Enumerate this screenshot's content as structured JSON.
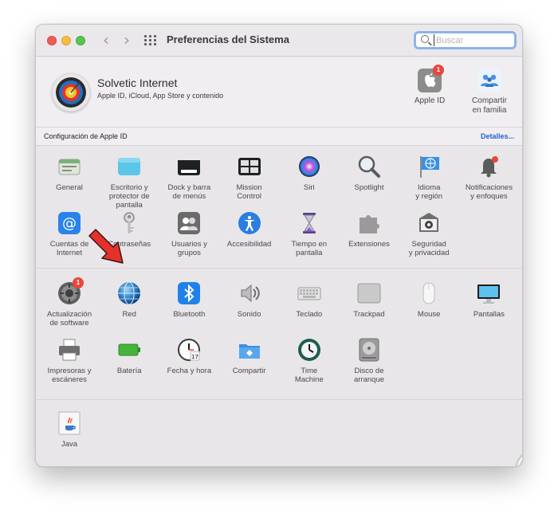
{
  "window": {
    "title": "Preferencias del Sistema"
  },
  "toolbar": {
    "back_icon": "chevron-left-icon",
    "forward_icon": "chevron-right-icon",
    "grid_icon": "grid-icon"
  },
  "search": {
    "placeholder": "Buscar"
  },
  "account": {
    "name": "Solvetic Internet",
    "subtitle": "Apple ID, iCloud, App Store y contenido",
    "apple_id_label": "Apple ID",
    "apple_id_badge": "1",
    "family_label": "Compartir\nen familia"
  },
  "apple_bar": {
    "title": "Configuración de Apple ID",
    "details_link": "Detalles..."
  },
  "section1": [
    {
      "label": "General",
      "icon": "general-icon"
    },
    {
      "label": "Escritorio y\nprotector de pantalla",
      "icon": "desktop-icon"
    },
    {
      "label": "Dock y barra\nde menús",
      "icon": "dock-icon"
    },
    {
      "label": "Mission\nControl",
      "icon": "mission-control-icon"
    },
    {
      "label": "Siri",
      "icon": "siri-icon"
    },
    {
      "label": "Spotlight",
      "icon": "spotlight-icon"
    },
    {
      "label": "Idioma\ny región",
      "icon": "language-icon"
    },
    {
      "label": "Notificaciones\ny enfoques",
      "icon": "bell-icon"
    },
    {
      "label": "Cuentas de\nInternet",
      "icon": "at-icon"
    },
    {
      "label": "Contraseñas",
      "icon": "key-icon"
    },
    {
      "label": "Usuarios y\ngrupos",
      "icon": "users-icon"
    },
    {
      "label": "Accesibilidad",
      "icon": "accessibility-icon"
    },
    {
      "label": "Tiempo en\npantalla",
      "icon": "hourglass-icon"
    },
    {
      "label": "Extensiones",
      "icon": "puzzle-icon"
    },
    {
      "label": "Seguridad\ny privacidad",
      "icon": "security-icon"
    }
  ],
  "section2": [
    {
      "label": "Actualización\nde software",
      "icon": "software-update-icon",
      "badge": "1"
    },
    {
      "label": "Red",
      "icon": "network-icon"
    },
    {
      "label": "Bluetooth",
      "icon": "bluetooth-icon"
    },
    {
      "label": "Sonido",
      "icon": "speaker-icon"
    },
    {
      "label": "Teclado",
      "icon": "keyboard-icon"
    },
    {
      "label": "Trackpad",
      "icon": "trackpad-icon"
    },
    {
      "label": "Mouse",
      "icon": "mouse-icon"
    },
    {
      "label": "Pantallas",
      "icon": "display-icon"
    },
    {
      "label": "Impresoras y\nescáneres",
      "icon": "printer-icon"
    },
    {
      "label": "Batería",
      "icon": "battery-icon"
    },
    {
      "label": "Fecha y hora",
      "icon": "clock-icon"
    },
    {
      "label": "Compartir",
      "icon": "sharing-folder-icon"
    },
    {
      "label": "Time\nMachine",
      "icon": "time-machine-icon"
    },
    {
      "label": "Disco de\narranque",
      "icon": "startup-disk-icon"
    }
  ],
  "section3": [
    {
      "label": "Java",
      "icon": "java-icon"
    }
  ],
  "colors": {
    "accent": "#1b63d1",
    "badge": "#e9463d",
    "window_bg": "#e9e6e9",
    "arrow": "#e5312b"
  }
}
